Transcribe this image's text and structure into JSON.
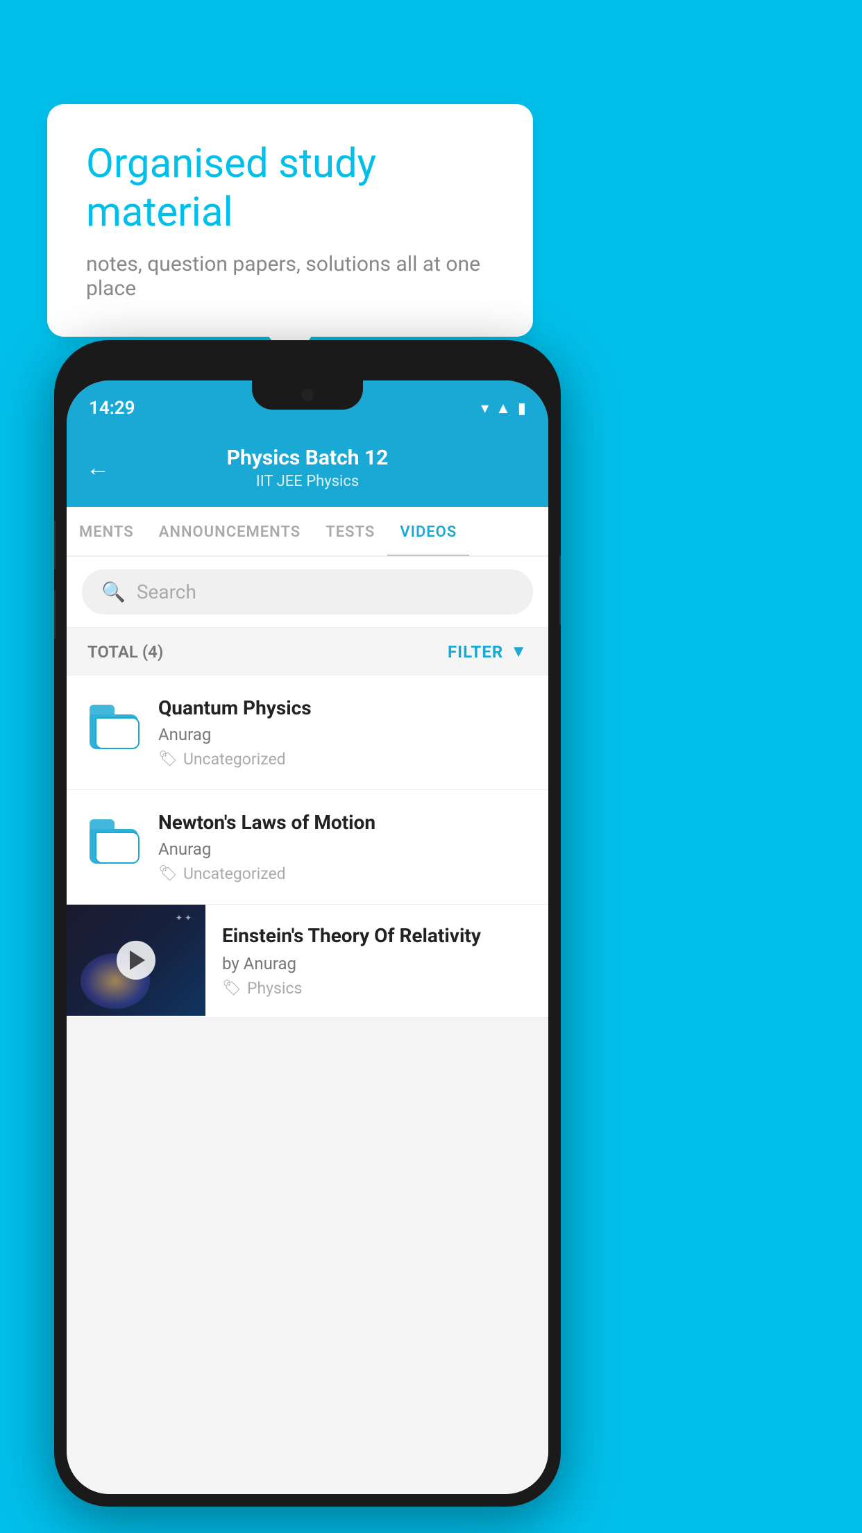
{
  "background": {
    "color": "#00BFEA"
  },
  "speech_bubble": {
    "title": "Organised study material",
    "subtitle": "notes, question papers, solutions all at one place"
  },
  "phone": {
    "status_bar": {
      "time": "14:29"
    },
    "header": {
      "back_label": "←",
      "title": "Physics Batch 12",
      "subtitle_tags": "IIT JEE   Physics"
    },
    "tabs": [
      {
        "label": "MENTS",
        "active": false
      },
      {
        "label": "ANNOUNCEMENTS",
        "active": false
      },
      {
        "label": "TESTS",
        "active": false
      },
      {
        "label": "VIDEOS",
        "active": true
      }
    ],
    "search": {
      "placeholder": "Search"
    },
    "total": {
      "label": "TOTAL (4)",
      "filter_label": "FILTER"
    },
    "list_items": [
      {
        "title": "Quantum Physics",
        "author": "Anurag",
        "tag": "Uncategorized",
        "type": "folder"
      },
      {
        "title": "Newton's Laws of Motion",
        "author": "Anurag",
        "tag": "Uncategorized",
        "type": "folder"
      },
      {
        "title": "Einstein's Theory Of Relativity",
        "author": "by Anurag",
        "tag": "Physics",
        "type": "video"
      }
    ]
  }
}
